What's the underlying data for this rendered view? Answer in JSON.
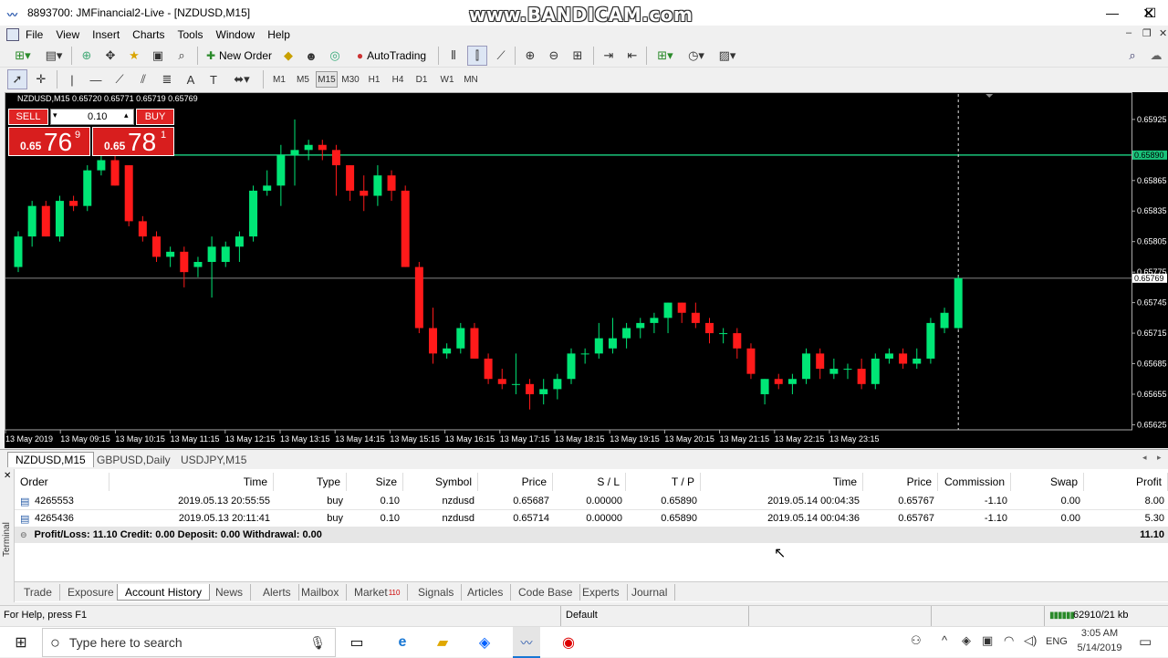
{
  "window": {
    "title": "8893700: JMFinancial2-Live - [NZDUSD,M15]",
    "watermark": "www.BANDICAM.com"
  },
  "menu": [
    "File",
    "View",
    "Insert",
    "Charts",
    "Tools",
    "Window",
    "Help"
  ],
  "toolbar": {
    "new_order": "New Order",
    "auto_trading": "AutoTrading"
  },
  "timeframes": [
    "M1",
    "M5",
    "M15",
    "M30",
    "H1",
    "H4",
    "D1",
    "W1",
    "MN"
  ],
  "active_timeframe": "M15",
  "chart": {
    "header": "NZDUSD,M15  0.65720 0.65771 0.65719 0.65769",
    "trade_panel": {
      "sell_label": "SELL",
      "buy_label": "BUY",
      "lot": "0.10",
      "sell_big": "0.65",
      "sell_pips": "76",
      "sell_frac": "9",
      "buy_big": "0.65",
      "buy_pips": "78",
      "buy_frac": "1"
    },
    "price_marker_tp": "0.65890",
    "price_marker_current": "0.65769",
    "y_ticks": [
      "0.65925",
      "0.65890",
      "0.65865",
      "0.65835",
      "0.65805",
      "0.65775",
      "0.65769",
      "0.65745",
      "0.65715",
      "0.65685",
      "0.65655",
      "0.65625"
    ],
    "x_ticks": [
      "13 May 2019",
      "13 May 09:15",
      "13 May 10:15",
      "13 May 11:15",
      "13 May 12:15",
      "13 May 13:15",
      "13 May 14:15",
      "13 May 15:15",
      "13 May 16:15",
      "13 May 17:15",
      "13 May 18:15",
      "13 May 19:15",
      "13 May 20:15",
      "13 May 21:15",
      "13 May 22:15",
      "13 May 23:15"
    ],
    "colors": {
      "bull": "#00e676",
      "bear": "#ff1a1a",
      "tp_line": "#19c27a",
      "bg": "#000000"
    }
  },
  "chart_data": {
    "type": "candlestick",
    "symbol": "NZDUSD",
    "timeframe": "M15",
    "ylim": [
      0.6562,
      0.6595
    ],
    "candles": [
      [
        0.6578,
        0.65815,
        0.65775,
        0.6581
      ],
      [
        0.6581,
        0.65845,
        0.658,
        0.6584
      ],
      [
        0.6584,
        0.65845,
        0.6581,
        0.6581
      ],
      [
        0.6581,
        0.6585,
        0.65805,
        0.65845
      ],
      [
        0.65845,
        0.6585,
        0.65835,
        0.6584
      ],
      [
        0.6584,
        0.6588,
        0.65835,
        0.65875
      ],
      [
        0.65875,
        0.65905,
        0.6587,
        0.65885
      ],
      [
        0.65885,
        0.6589,
        0.6586,
        0.6586
      ],
      [
        0.6588,
        0.6588,
        0.6582,
        0.65825
      ],
      [
        0.65825,
        0.6583,
        0.65805,
        0.6581
      ],
      [
        0.6581,
        0.65815,
        0.65785,
        0.6579
      ],
      [
        0.6579,
        0.658,
        0.6578,
        0.65795
      ],
      [
        0.65795,
        0.658,
        0.6576,
        0.65775
      ],
      [
        0.6578,
        0.6579,
        0.6577,
        0.65785
      ],
      [
        0.65785,
        0.6581,
        0.6575,
        0.658
      ],
      [
        0.65785,
        0.65805,
        0.6578,
        0.658
      ],
      [
        0.658,
        0.65815,
        0.65785,
        0.6581
      ],
      [
        0.6581,
        0.6586,
        0.65805,
        0.65855
      ],
      [
        0.65855,
        0.65875,
        0.6585,
        0.6586
      ],
      [
        0.6586,
        0.659,
        0.6584,
        0.6589
      ],
      [
        0.6589,
        0.65925,
        0.6586,
        0.65895
      ],
      [
        0.65895,
        0.65905,
        0.65885,
        0.659
      ],
      [
        0.659,
        0.65905,
        0.65885,
        0.65895
      ],
      [
        0.65895,
        0.659,
        0.6585,
        0.6588
      ],
      [
        0.6588,
        0.6588,
        0.65845,
        0.65855
      ],
      [
        0.65855,
        0.6587,
        0.65835,
        0.6585
      ],
      [
        0.6585,
        0.6588,
        0.6584,
        0.6587
      ],
      [
        0.6587,
        0.65875,
        0.65845,
        0.65855
      ],
      [
        0.65855,
        0.6586,
        0.6578,
        0.6578
      ],
      [
        0.6578,
        0.65785,
        0.65715,
        0.6572
      ],
      [
        0.6572,
        0.6574,
        0.65685,
        0.65695
      ],
      [
        0.65695,
        0.65705,
        0.6569,
        0.657
      ],
      [
        0.657,
        0.65725,
        0.65695,
        0.6572
      ],
      [
        0.6572,
        0.65725,
        0.6569,
        0.6569
      ],
      [
        0.6569,
        0.65695,
        0.65665,
        0.6567
      ],
      [
        0.6567,
        0.6568,
        0.6566,
        0.65665
      ],
      [
        0.65665,
        0.65695,
        0.65655,
        0.65665
      ],
      [
        0.65665,
        0.6567,
        0.6564,
        0.65655
      ],
      [
        0.65655,
        0.6567,
        0.65645,
        0.6566
      ],
      [
        0.6566,
        0.65675,
        0.6565,
        0.6567
      ],
      [
        0.6567,
        0.657,
        0.65665,
        0.65695
      ],
      [
        0.65695,
        0.657,
        0.65685,
        0.65695
      ],
      [
        0.65695,
        0.65725,
        0.6569,
        0.6571
      ],
      [
        0.657,
        0.6573,
        0.65695,
        0.6571
      ],
      [
        0.6571,
        0.65725,
        0.657,
        0.6572
      ],
      [
        0.6572,
        0.6573,
        0.6571,
        0.65725
      ],
      [
        0.65725,
        0.65735,
        0.65715,
        0.6573
      ],
      [
        0.6573,
        0.65745,
        0.65715,
        0.65745
      ],
      [
        0.65745,
        0.65745,
        0.65725,
        0.65735
      ],
      [
        0.65735,
        0.65745,
        0.6572,
        0.65725
      ],
      [
        0.65725,
        0.6573,
        0.65705,
        0.65715
      ],
      [
        0.65715,
        0.6572,
        0.65705,
        0.65715
      ],
      [
        0.65715,
        0.6572,
        0.6569,
        0.657
      ],
      [
        0.657,
        0.65705,
        0.6567,
        0.65675
      ],
      [
        0.65655,
        0.6567,
        0.65645,
        0.6567
      ],
      [
        0.6567,
        0.65675,
        0.6566,
        0.65665
      ],
      [
        0.65665,
        0.65675,
        0.65655,
        0.6567
      ],
      [
        0.6567,
        0.657,
        0.65665,
        0.65695
      ],
      [
        0.65695,
        0.657,
        0.6567,
        0.6568
      ],
      [
        0.65675,
        0.6569,
        0.6567,
        0.6568
      ],
      [
        0.6568,
        0.65685,
        0.6567,
        0.6568
      ],
      [
        0.6568,
        0.6569,
        0.6566,
        0.65665
      ],
      [
        0.65665,
        0.65695,
        0.6566,
        0.6569
      ],
      [
        0.6569,
        0.657,
        0.65685,
        0.65695
      ],
      [
        0.65695,
        0.657,
        0.6568,
        0.65685
      ],
      [
        0.65685,
        0.657,
        0.6568,
        0.6569
      ],
      [
        0.6569,
        0.6573,
        0.65685,
        0.65725
      ],
      [
        0.6572,
        0.6574,
        0.65715,
        0.65735
      ],
      [
        0.6572,
        0.65771,
        0.65719,
        0.65769
      ]
    ]
  },
  "symbol_tabs": [
    "NZDUSD,M15",
    "GBPUSD,Daily",
    "USDJPY,M15"
  ],
  "history": {
    "columns": [
      "Order",
      "Time",
      "Type",
      "Size",
      "Symbol",
      "Price",
      "S / L",
      "T / P",
      "Time",
      "Price",
      "Commission",
      "Swap",
      "Profit"
    ],
    "rows": [
      [
        "4265553",
        "2019.05.13 20:55:55",
        "buy",
        "0.10",
        "nzdusd",
        "0.65687",
        "0.00000",
        "0.65890",
        "2019.05.14 00:04:35",
        "0.65767",
        "-1.10",
        "0.00",
        "8.00"
      ],
      [
        "4265436",
        "2019.05.13 20:11:41",
        "buy",
        "0.10",
        "nzdusd",
        "0.65714",
        "0.00000",
        "0.65890",
        "2019.05.14 00:04:36",
        "0.65767",
        "-1.10",
        "0.00",
        "5.30"
      ]
    ],
    "summary": "Profit/Loss: 11.10  Credit: 0.00  Deposit: 0.00  Withdrawal: 0.00",
    "summary_total": "11.10"
  },
  "terminal_label": "Terminal",
  "terminal_tabs": [
    "Trade",
    "Exposure",
    "Account History",
    "News",
    "Alerts",
    "Mailbox",
    "Market",
    "Signals",
    "Articles",
    "Code Base",
    "Experts",
    "Journal"
  ],
  "market_badge": "110",
  "active_terminal_tab": "Account History",
  "status": {
    "help": "For Help, press F1",
    "profile": "Default",
    "traffic": "62910/21 kb"
  },
  "taskbar": {
    "search_placeholder": "Type here to search",
    "lang": "ENG",
    "time": "3:05 AM",
    "date": "5/14/2019"
  }
}
